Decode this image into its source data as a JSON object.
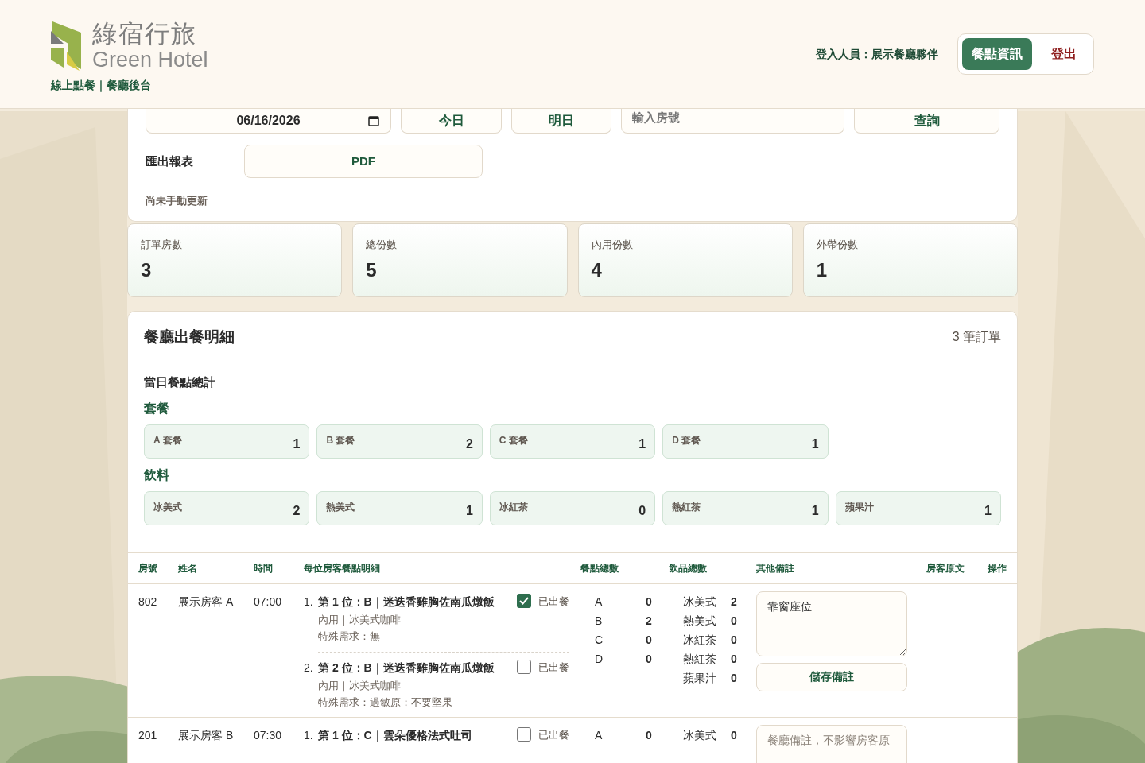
{
  "header": {
    "logo_title": "綠宿行旅",
    "logo_subtitle": "Green Hotel",
    "tagline": "線上點餐｜餐廳後台",
    "login_label": "登入人員：展示餐廳夥伴",
    "nav": [
      {
        "label": "餐點資訊",
        "selected": true
      }
    ],
    "logout": "登出"
  },
  "filters": {
    "date": "06/16/2026",
    "today": "今日",
    "tomorrow": "明日",
    "room_placeholder": "輸入房號",
    "query": "查詢",
    "export_label": "匯出報表",
    "pdf": "PDF",
    "update_status": "尚未手動更新"
  },
  "stats": [
    {
      "label": "訂單房數",
      "value": "3"
    },
    {
      "label": "總份數",
      "value": "5"
    },
    {
      "label": "內用份數",
      "value": "4"
    },
    {
      "label": "外帶份數",
      "value": "1"
    }
  ],
  "detail": {
    "title": "餐廳出餐明細",
    "count": "3 筆訂單",
    "summary_title": "當日餐點總計",
    "groups": [
      {
        "title": "套餐",
        "items": [
          {
            "label": "A 套餐",
            "value": "1"
          },
          {
            "label": "B 套餐",
            "value": "2"
          },
          {
            "label": "C 套餐",
            "value": "1"
          },
          {
            "label": "D 套餐",
            "value": "1"
          }
        ]
      },
      {
        "title": "飲料",
        "items": [
          {
            "label": "冰美式",
            "value": "2"
          },
          {
            "label": "熱美式",
            "value": "1"
          },
          {
            "label": "冰紅茶",
            "value": "0"
          },
          {
            "label": "熱紅茶",
            "value": "1"
          },
          {
            "label": "蘋果汁",
            "value": "1"
          }
        ]
      }
    ]
  },
  "table": {
    "columns": [
      "房號",
      "姓名",
      "時間",
      "每位房客餐點明細",
      "餐點總數",
      "飲品總數",
      "其他備註",
      "房客原文",
      "操作"
    ],
    "rows": [
      {
        "room": "802",
        "name": "展示房客 A",
        "time": "07:00",
        "orders": [
          {
            "num": "1.",
            "title": "第 1 位：B｜迷迭香雞胸佐南瓜燉飯",
            "lines": [
              "內用｜冰美式咖啡",
              "特殊需求：無"
            ],
            "served_label": "已出餐",
            "served": true
          },
          {
            "num": "2.",
            "title": "第 2 位：B｜迷迭香雞胸佐南瓜燉飯",
            "lines": [
              "內用｜冰美式咖啡",
              "特殊需求：過敏原；不要堅果"
            ],
            "served_label": "已出餐",
            "served": false
          }
        ],
        "meal_totals": [
          {
            "label": "A",
            "value": "0"
          },
          {
            "label": "B",
            "value": "2"
          },
          {
            "label": "C",
            "value": "0"
          },
          {
            "label": "D",
            "value": "0"
          }
        ],
        "drink_totals": [
          {
            "label": "冰美式",
            "value": "2"
          },
          {
            "label": "熱美式",
            "value": "0"
          },
          {
            "label": "冰紅茶",
            "value": "0"
          },
          {
            "label": "熱紅茶",
            "value": "0"
          },
          {
            "label": "蘋果汁",
            "value": "0"
          }
        ],
        "note_value": "靠窗座位",
        "save_label": "儲存備註"
      },
      {
        "room": "201",
        "name": "展示房客 B",
        "time": "07:30",
        "orders": [
          {
            "num": "1.",
            "title": "第 1 位：C｜雲朵優格法式吐司",
            "served_label": "已出餐",
            "served": false
          }
        ],
        "meal_totals": [
          {
            "label": "A",
            "value": "0"
          }
        ],
        "drink_totals": [
          {
            "label": "冰美式",
            "value": "0"
          }
        ],
        "note_placeholder": "餐廳備註，不影響房客原"
      }
    ]
  }
}
